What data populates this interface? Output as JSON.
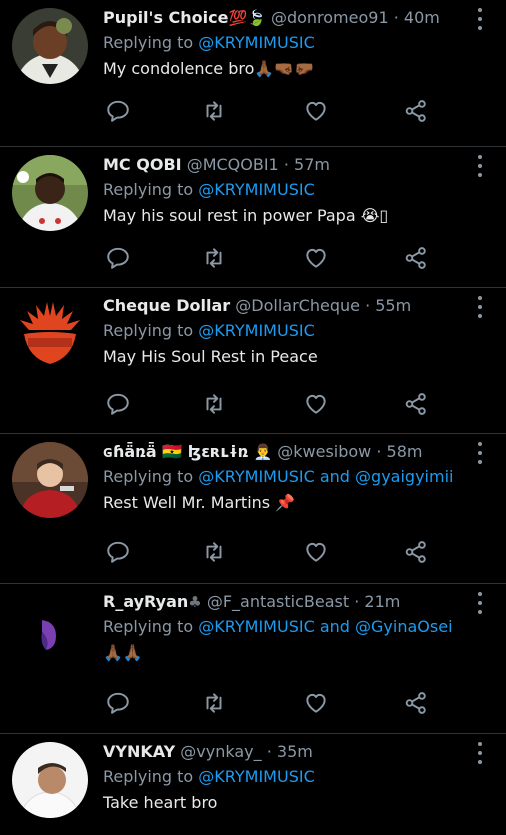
{
  "tweets": [
    {
      "name": "Pupil's Choice",
      "name_suffix": "💯🍃",
      "handle": "@donromeo91",
      "dot": "·",
      "time": "40m",
      "replying_prefix": "Replying to ",
      "mention_1": "@KRYMIMUSIC",
      "mention_joiner": "",
      "mention_2": "",
      "text": "My condolence bro🙏🏾🤜🏾🤛🏾"
    },
    {
      "name": "MC QOBI",
      "name_suffix": "",
      "handle": "@MCQOBI1",
      "dot": "·",
      "time": "57m",
      "replying_prefix": "Replying to ",
      "mention_1": "@KRYMIMUSIC",
      "mention_joiner": "",
      "mention_2": "",
      "text": "May his soul rest in power Papa 😭▯"
    },
    {
      "name": "Cheque Dollar",
      "name_suffix": "",
      "handle": "@DollarCheque",
      "dot": "·",
      "time": "55m",
      "replying_prefix": "Replying to ",
      "mention_1": "@KRYMIMUSIC",
      "mention_joiner": "",
      "mention_2": "",
      "text": "May His Soul Rest in Peace"
    },
    {
      "name": "ɢɦǟռǟ 🇬🇭 ɮɛʀʟɨռ",
      "name_suffix": "👨‍💼",
      "handle": "@kwesibow",
      "dot": "·",
      "time": "58m",
      "replying_prefix": "Replying to ",
      "mention_1": "@KRYMIMUSIC",
      "mention_joiner": " and ",
      "mention_2": "@gyaigyimii",
      "text": "Rest Well Mr. Martins 📌"
    },
    {
      "name": "R_ayRyan",
      "name_suffix": "♣",
      "handle": "@F_antasticBeast",
      "dot": "·",
      "time": "21m",
      "replying_prefix": "Replying to ",
      "mention_1": "@KRYMIMUSIC",
      "mention_joiner": " and ",
      "mention_2": "@GyinaOsei",
      "text": "🙏🏾🙏🏾"
    },
    {
      "name": "VYNKAY",
      "name_suffix": "",
      "handle": "@vynkay_",
      "dot": "·",
      "time": "35m",
      "replying_prefix": "Replying to ",
      "mention_1": "@KRYMIMUSIC",
      "mention_joiner": "",
      "mention_2": "",
      "text": "Take heart bro"
    }
  ],
  "icons": {
    "reply": "reply-icon",
    "retweet": "retweet-icon",
    "like": "like-icon",
    "share": "share-icon",
    "more": "more-icon"
  },
  "colors": {
    "background": "#000000",
    "text": "#e7e9ea",
    "secondary": "#8b98a5",
    "accent": "#1d9bf0",
    "divider": "#2f3336"
  }
}
